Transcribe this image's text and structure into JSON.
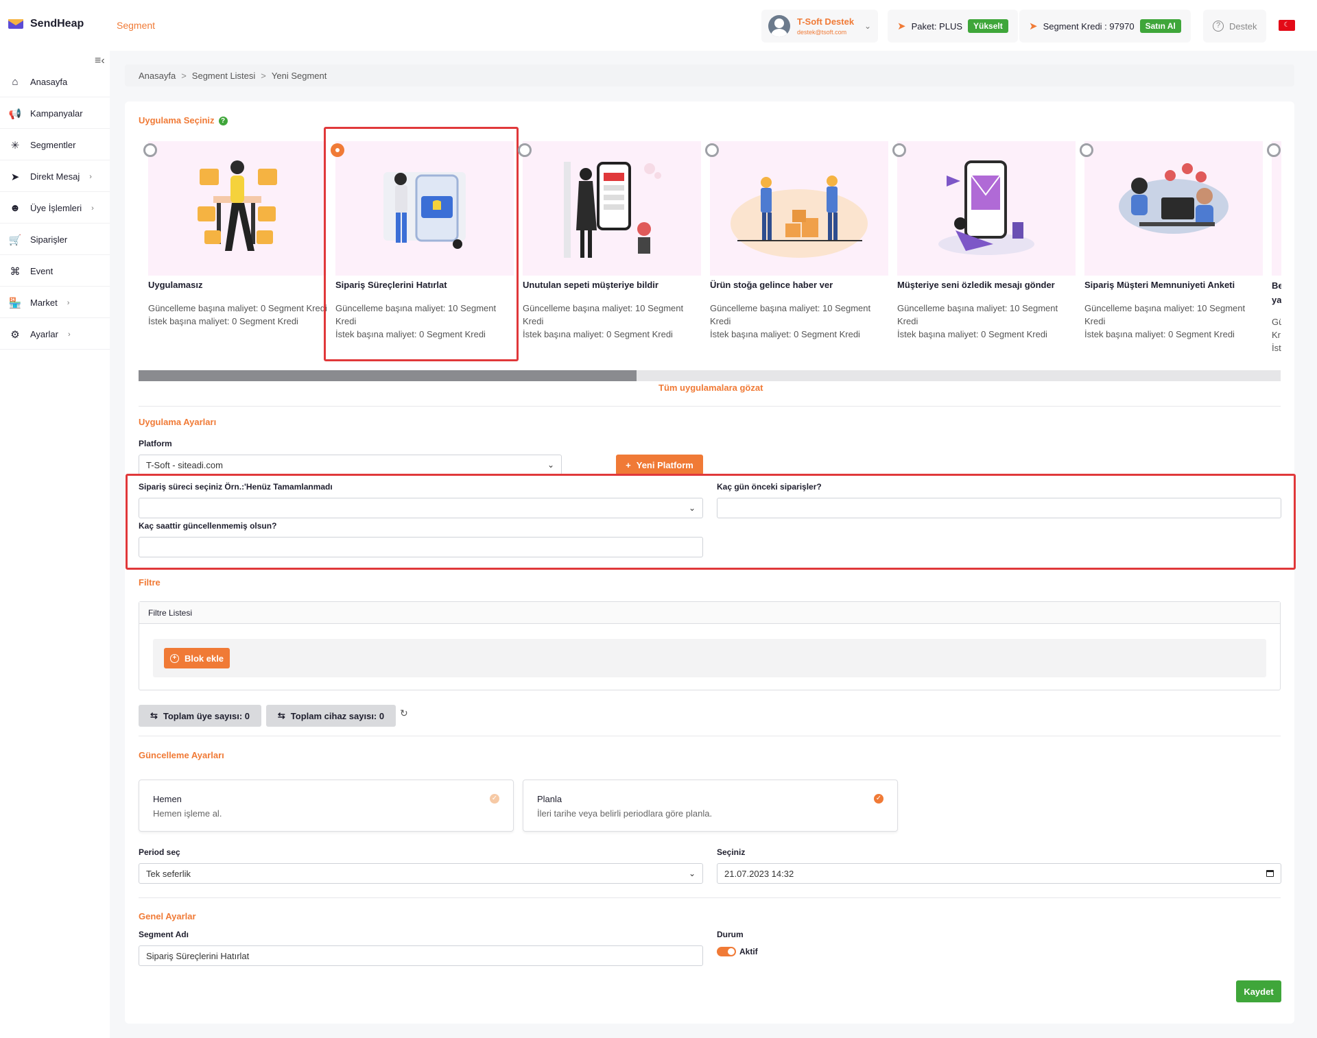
{
  "header": {
    "brand": "SendHeap",
    "page_tag": "Segment",
    "user_name": "T-Soft Destek",
    "user_email": "destek@tsoft.com",
    "package_label": "Paket: PLUS",
    "upgrade_label": "Yükselt",
    "credit_label": "Segment Kredi : 97970",
    "buy_label": "Satın Al",
    "support_label": "Destek"
  },
  "sidebar": {
    "items": [
      {
        "label": "Anasayfa",
        "icon": "home-icon"
      },
      {
        "label": "Kampanyalar",
        "icon": "megaphone-icon"
      },
      {
        "label": "Segmentler",
        "icon": "network-icon"
      },
      {
        "label": "Direkt Mesaj",
        "icon": "send-icon"
      },
      {
        "label": "Üye İşlemleri",
        "icon": "users-icon"
      },
      {
        "label": "Siparişler",
        "icon": "cart-icon"
      },
      {
        "label": "Event",
        "icon": "command-icon"
      },
      {
        "label": "Market",
        "icon": "store-icon"
      },
      {
        "label": "Ayarlar",
        "icon": "gear-icon"
      }
    ]
  },
  "breadcrumb": [
    "Anasayfa",
    "Segment Listesi",
    "Yeni Segment"
  ],
  "apps": {
    "title": "Uygulama Seçiniz",
    "browse_all": "Tüm uygulamalara gözat",
    "items": [
      {
        "title": "Uygulamasız",
        "desc1": "Güncelleme başına maliyet: 0 Segment Kredi",
        "desc2": "İstek başına maliyet: 0 Segment Kredi"
      },
      {
        "title": "Sipariş Süreçlerini Hatırlat",
        "desc1": "Güncelleme başına maliyet: 10 Segment Kredi",
        "desc2": "İstek başına maliyet: 0 Segment Kredi"
      },
      {
        "title": "Unutulan sepeti müşteriye bildir",
        "desc1": "Güncelleme başına maliyet: 10 Segment Kredi",
        "desc2": "İstek başına maliyet: 0 Segment Kredi"
      },
      {
        "title": "Ürün stoğa gelince haber ver",
        "desc1": "Güncelleme başına maliyet: 10 Segment Kredi",
        "desc2": "İstek başına maliyet: 0 Segment Kredi"
      },
      {
        "title": "Müşteriye seni özledik mesajı gönder",
        "desc1": "Güncelleme başına maliyet: 10 Segment Kredi",
        "desc2": "İstek başına maliyet: 0 Segment Kredi"
      },
      {
        "title": "Sipariş Müşteri Memnuniyeti Anketi",
        "desc1": "Güncelleme başına maliyet: 10 Segment Kredi",
        "desc2": "İstek başına maliyet: 0 Segment Kredi"
      }
    ],
    "partial": {
      "title1": "Be",
      "title2": "ya",
      "desc1": "Gü",
      "desc2": "Kr",
      "desc3": "İst"
    }
  },
  "app_settings": {
    "title": "Uygulama Ayarları",
    "platform_label": "Platform",
    "platform_value": "T-Soft - siteadi.com",
    "new_platform": "Yeni Platform",
    "order_status_label": "Sipariş süreci seçiniz Örn.:'Henüz Tamamlanmadı",
    "order_status_value": "",
    "days_label": "Kaç gün önceki siparişler?",
    "days_value": "",
    "hours_label": "Kaç saattir güncellenmemiş olsun?",
    "hours_value": ""
  },
  "filter": {
    "title": "Filtre",
    "list_label": "Filtre Listesi",
    "add_block": "Blok ekle",
    "total_members": "Toplam üye sayısı: 0",
    "total_devices": "Toplam cihaz sayısı: 0"
  },
  "update_settings": {
    "title": "Güncelleme Ayarları",
    "now_title": "Hemen",
    "now_sub": "Hemen işleme al.",
    "plan_title": "Planla",
    "plan_sub": "İleri tarihe veya belirli periodlara göre planla.",
    "selected": "Planla",
    "period_label": "Period seç",
    "period_value": "Tek seferlik",
    "date_label": "Seçiniz",
    "date_value": "21.07.2023 14:32"
  },
  "general": {
    "title": "Genel Ayarlar",
    "name_label": "Segment Adı",
    "name_value": "Sipariş Süreçlerini Hatırlat",
    "status_label": "Durum",
    "status_value": "Aktif",
    "save": "Kaydet"
  },
  "colors": {
    "accent": "#f07a36",
    "success": "#3fa63a",
    "highlight": "#e0383a"
  }
}
